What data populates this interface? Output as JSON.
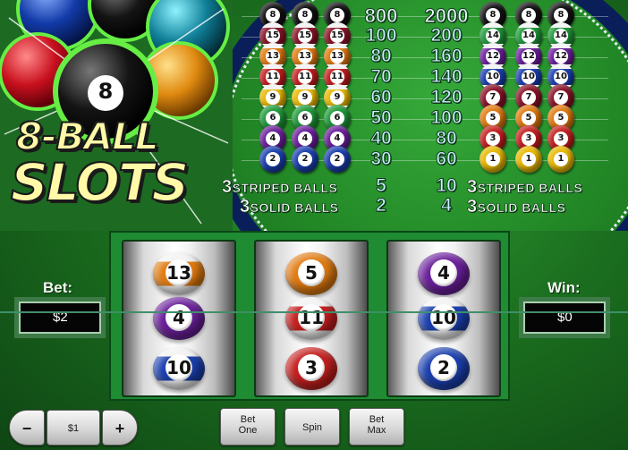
{
  "game": {
    "logo_line1": "8-BALL",
    "logo_line2": "SLOTS",
    "logo_ball_number": "8"
  },
  "paytable": {
    "rows": [
      {
        "left_balls": [
          "8",
          "8",
          "8"
        ],
        "left_type": "solid",
        "left_color": "#111111",
        "payout1": "800",
        "payout2": "2000",
        "right_balls": [
          "8",
          "8",
          "8"
        ],
        "right_type": "solid",
        "right_color": "#111111"
      },
      {
        "left_balls": [
          "15",
          "15",
          "15"
        ],
        "left_type": "striped",
        "left_color": "#8a1428",
        "payout1": "100",
        "payout2": "200",
        "right_balls": [
          "14",
          "14",
          "14"
        ],
        "right_type": "striped",
        "right_color": "#1f9a3a"
      },
      {
        "left_balls": [
          "13",
          "13",
          "13"
        ],
        "left_type": "striped",
        "left_color": "#e07a10",
        "payout1": "80",
        "payout2": "160",
        "right_balls": [
          "12",
          "12",
          "12"
        ],
        "right_type": "striped",
        "right_color": "#6a1f9a"
      },
      {
        "left_balls": [
          "11",
          "11",
          "11"
        ],
        "left_type": "striped",
        "left_color": "#c41e1e",
        "payout1": "70",
        "payout2": "140",
        "right_balls": [
          "10",
          "10",
          "10"
        ],
        "right_type": "striped",
        "right_color": "#1a3fae"
      },
      {
        "left_balls": [
          "9",
          "9",
          "9"
        ],
        "left_type": "striped",
        "left_color": "#e8b800",
        "payout1": "60",
        "payout2": "120",
        "right_balls": [
          "7",
          "7",
          "7"
        ],
        "right_type": "solid",
        "right_color": "#8a1428"
      },
      {
        "left_balls": [
          "6",
          "6",
          "6"
        ],
        "left_type": "solid",
        "left_color": "#1f9a3a",
        "payout1": "50",
        "payout2": "100",
        "right_balls": [
          "5",
          "5",
          "5"
        ],
        "right_type": "solid",
        "right_color": "#e07a10"
      },
      {
        "left_balls": [
          "4",
          "4",
          "4"
        ],
        "left_type": "solid",
        "left_color": "#6a1f9a",
        "payout1": "40",
        "payout2": "80",
        "right_balls": [
          "3",
          "3",
          "3"
        ],
        "right_type": "solid",
        "right_color": "#c41e1e"
      },
      {
        "left_balls": [
          "2",
          "2",
          "2"
        ],
        "left_type": "solid",
        "left_color": "#1a3fae",
        "payout1": "30",
        "payout2": "60",
        "right_balls": [
          "1",
          "1",
          "1"
        ],
        "right_type": "solid",
        "right_color": "#e8b800"
      }
    ],
    "striped_left": {
      "count": "3",
      "label": "STRIPED BALLS"
    },
    "striped_payout1": "5",
    "striped_payout2": "10",
    "striped_right": {
      "count": "3",
      "label": "STRIPED BALLS"
    },
    "solid_left": {
      "count": "3",
      "label": "SOLID BALLS"
    },
    "solid_payout1": "2",
    "solid_payout2": "4",
    "solid_right": {
      "count": "3",
      "label": "SOLID BALLS"
    }
  },
  "bet": {
    "label": "Bet:",
    "value": "$2"
  },
  "win": {
    "label": "Win:",
    "value": "$0"
  },
  "reels": [
    [
      {
        "number": "13",
        "type": "striped",
        "color": "#e07a10"
      },
      {
        "number": "4",
        "type": "solid",
        "color": "#6a1f9a"
      },
      {
        "number": "10",
        "type": "striped",
        "color": "#1a3fae"
      }
    ],
    [
      {
        "number": "5",
        "type": "solid",
        "color": "#e07a10"
      },
      {
        "number": "11",
        "type": "striped",
        "color": "#c41e1e"
      },
      {
        "number": "3",
        "type": "solid",
        "color": "#c41e1e"
      }
    ],
    [
      {
        "number": "4",
        "type": "solid",
        "color": "#6a1f9a"
      },
      {
        "number": "10",
        "type": "striped",
        "color": "#1a3fae"
      },
      {
        "number": "2",
        "type": "solid",
        "color": "#1a3fae"
      }
    ]
  ],
  "controls": {
    "decrease_label": "−",
    "coin_value": "$1",
    "increase_label": "+",
    "bet_one_line1": "Bet",
    "bet_one_line2": "One",
    "spin_label": "Spin",
    "bet_max_line1": "Bet",
    "bet_max_line2": "Max"
  },
  "colors": {
    "table_green": "#238a27",
    "rail_navy": "#0a1f5a",
    "logo_yellow": "#fff9a8",
    "payout_text": "#c8f0ff"
  }
}
